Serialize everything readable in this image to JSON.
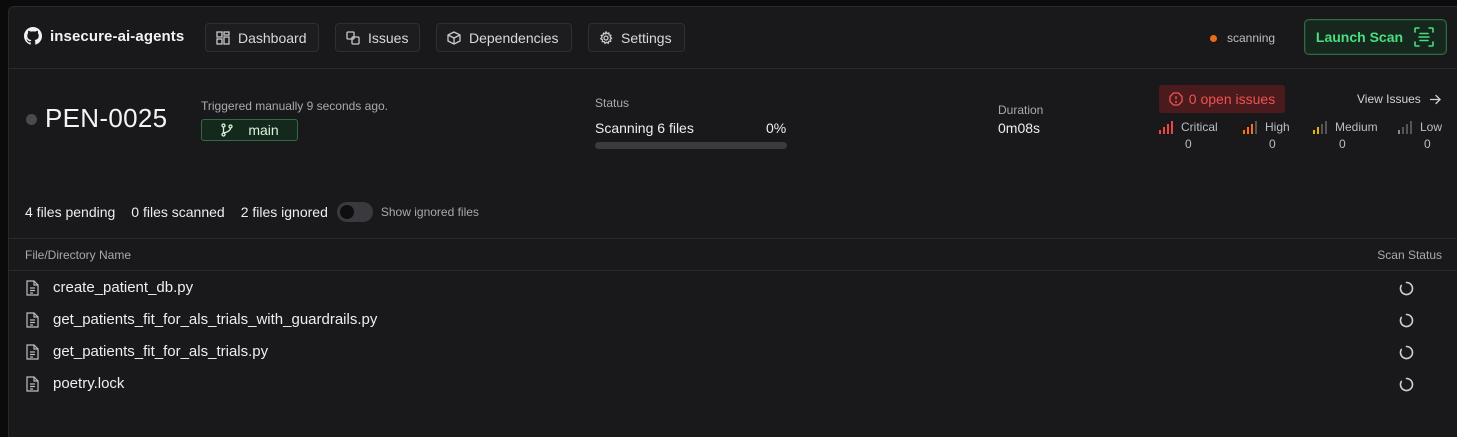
{
  "app": {
    "name": "insecure-ai-agents"
  },
  "nav": {
    "items": [
      {
        "label": "Dashboard",
        "icon": "dashboard-icon"
      },
      {
        "label": "Issues",
        "icon": "issues-icon"
      },
      {
        "label": "Dependencies",
        "icon": "package-icon"
      },
      {
        "label": "Settings",
        "icon": "gear-icon"
      }
    ],
    "scan_state": "scanning",
    "launch_label": "Launch Scan"
  },
  "run": {
    "id": "PEN-0025",
    "triggered": "Triggered manually 9 seconds ago.",
    "branch": "main",
    "status_label": "Status",
    "status_text": "Scanning 6 files",
    "progress_text": "0%",
    "progress_fraction": 0.0,
    "duration_label": "Duration",
    "duration": "0m08s",
    "open_issues": "0 open issues",
    "view_issues": "View Issues",
    "severities": [
      {
        "label": "Critical",
        "count": "0",
        "color": "#ef4444"
      },
      {
        "label": "High",
        "count": "0",
        "color": "#f97316"
      },
      {
        "label": "Medium",
        "count": "0",
        "color": "#eab308"
      },
      {
        "label": "Low",
        "count": "0",
        "color": "#8a8a90"
      }
    ]
  },
  "files_summary": {
    "pending": "4 files pending",
    "scanned": "0 files scanned",
    "ignored": "2 files ignored",
    "toggle_label": "Show ignored files",
    "toggle_on": false
  },
  "table": {
    "col_name": "File/Directory Name",
    "col_status": "Scan Status",
    "rows": [
      {
        "name": "create_patient_db.py",
        "status": "loading"
      },
      {
        "name": "get_patients_fit_for_als_trials_with_guardrails.py",
        "status": "loading"
      },
      {
        "name": "get_patients_fit_for_als_trials.py",
        "status": "loading"
      },
      {
        "name": "poetry.lock",
        "status": "loading"
      }
    ]
  },
  "colors": {
    "accent_green": "#4ade80",
    "scanning_dot": "#e86b1a",
    "issue_red": "#f05252"
  }
}
